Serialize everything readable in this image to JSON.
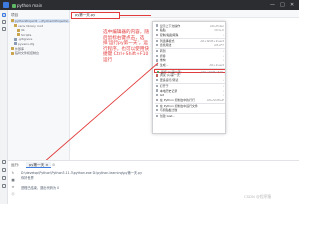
{
  "titlebar": {
    "project": "python  main",
    "minimize": "—",
    "maximize": "□",
    "close": "✕"
  },
  "project_panel": {
    "title": "项目",
    "tree": [
      {
        "label": "pythonProject1 ~/PycharmProjects/...",
        "kind": "folder",
        "selected": true
      },
      {
        "label": "venv  library root",
        "kind": "folder",
        "selected": false
      },
      {
        "label": "lib",
        "kind": "folder",
        "selected": false
      },
      {
        "label": "Scripts",
        "kind": "folder",
        "selected": false
      },
      {
        "label": ".gitignore",
        "kind": "file",
        "selected": false
      },
      {
        "label": "pyvenv.cfg",
        "kind": "file",
        "selected": false
      },
      {
        "label": "外部库",
        "kind": "folder",
        "selected": false
      },
      {
        "label": "临时文件和控制台",
        "kind": "folder",
        "selected": false
      }
    ]
  },
  "editor": {
    "tab_label": "py第一天.py"
  },
  "annotation": {
    "text": "选中编辑器的内容，随后鼠标右键点击，选择'运行py第一天'，运行程序，也可以使用快捷键 Ctrl+Shift+F10运行"
  },
  "context_menu": {
    "items": [
      {
        "label": "显示上下文操作",
        "shortcut": "Alt+Enter",
        "icon": "lightbulb-icon",
        "submenu": false
      },
      {
        "label": "粘贴",
        "shortcut": "Ctrl+V",
        "icon": "paste-icon",
        "submenu": false
      },
      {
        "label": "复制/粘贴特殊",
        "shortcut": "",
        "icon": "copy-icon",
        "submenu": true
      },
      {
        "label": "列选择模式",
        "shortcut": "Alt+Shift+Insert",
        "icon": "column-icon",
        "submenu": false
      },
      {
        "label": "查找用法",
        "shortcut": "Alt+F7",
        "icon": "find-icon",
        "submenu": false
      },
      {
        "label": "转到",
        "shortcut": "",
        "icon": "goto-icon",
        "submenu": true
      },
      {
        "label": "折叠",
        "shortcut": "",
        "icon": "fold-icon",
        "submenu": true
      },
      {
        "label": "重构",
        "shortcut": "",
        "icon": "refactor-icon",
        "submenu": true
      },
      {
        "label": "生成...",
        "shortcut": "Alt+Insert",
        "icon": "generate-icon",
        "submenu": false
      },
      {
        "label": "运行 'py第一天'",
        "shortcut": "Ctrl+Shift+F10",
        "icon": "run-icon",
        "submenu": false,
        "highlight": true
      },
      {
        "label": "调试 'py第一天'",
        "shortcut": "",
        "icon": "debug-icon",
        "submenu": false
      },
      {
        "label": "更多运行/调试",
        "shortcut": "",
        "icon": "more-run-icon",
        "submenu": true
      },
      {
        "label": "打开于",
        "shortcut": "",
        "icon": "open-in-icon",
        "submenu": true
      },
      {
        "label": "本地历史记录",
        "shortcut": "",
        "icon": "history-icon",
        "submenu": true
      },
      {
        "label": "Git",
        "shortcut": "",
        "icon": "git-icon",
        "submenu": true
      },
      {
        "label": "在 Python 控制台中执行行",
        "shortcut": "Alt+Shift+E",
        "icon": "console-icon",
        "submenu": false
      },
      {
        "label": "在 Python 控制台中运行文件",
        "shortcut": "",
        "icon": "console-run-icon",
        "submenu": false
      },
      {
        "label": "与剪贴板比较",
        "shortcut": "",
        "icon": "compare-icon",
        "submenu": false
      },
      {
        "label": "创建 Gist...",
        "shortcut": "",
        "icon": "gist-icon",
        "submenu": false
      }
    ]
  },
  "run_panel": {
    "label": "运行:",
    "tab": "py第一天 ×",
    "lines": [
      "D:\\develop\\Python\\Python3.11.3\\python.exe D:\\python-learning\\py第一天.py",
      "你好世界",
      "",
      "进程已结束，退出代码为 0"
    ]
  },
  "watermark": "CSDN @程序猿"
}
